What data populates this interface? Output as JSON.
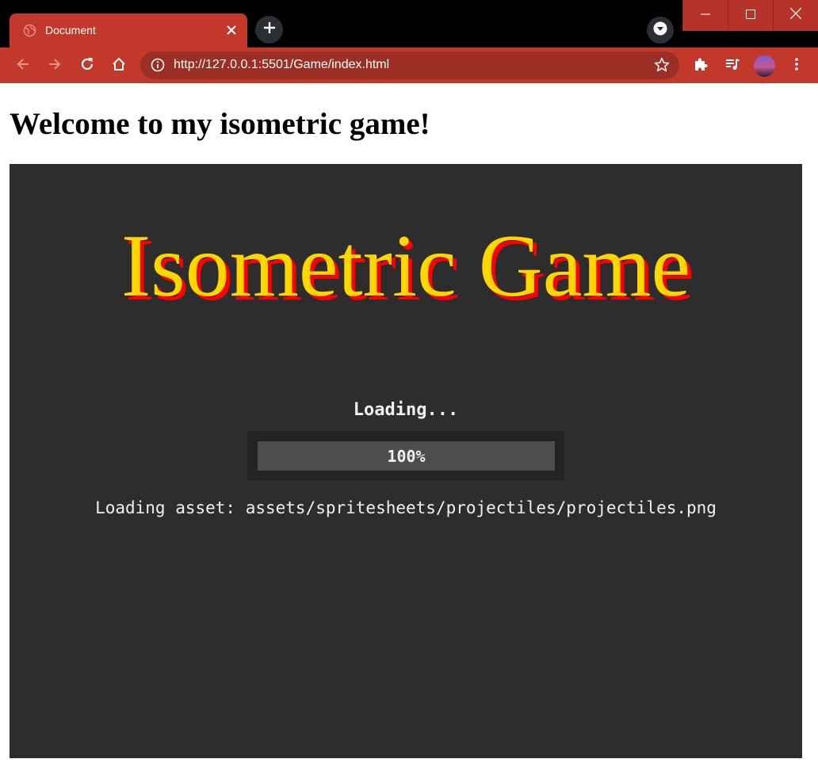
{
  "browser": {
    "tab": {
      "title": "Document"
    },
    "address_bar": {
      "url": "http://127.0.0.1:5501/Game/index.html"
    },
    "colors": {
      "frame": "#c2392c",
      "omnibox": "#9b2e25"
    }
  },
  "page": {
    "heading": "Welcome to my isometric game!"
  },
  "game": {
    "logo_text": "Isometric Game",
    "logo_colors": {
      "fill": "#ffd700",
      "shadow": "#ff0000"
    },
    "loading_label": "Loading...",
    "progress": {
      "value": 1.0,
      "label": "100%"
    },
    "asset_status": "Loading asset: assets/spritesheets/projectiles/projectiles.png"
  },
  "icons": [
    "globe-icon",
    "close-icon",
    "plus-icon",
    "chevron-down-icon",
    "minimize-icon",
    "maximize-icon",
    "window-close-icon",
    "back-arrow-icon",
    "forward-arrow-icon",
    "reload-icon",
    "home-icon",
    "info-icon",
    "star-icon",
    "puzzle-icon",
    "playlist-icon",
    "kebab-menu-icon"
  ]
}
